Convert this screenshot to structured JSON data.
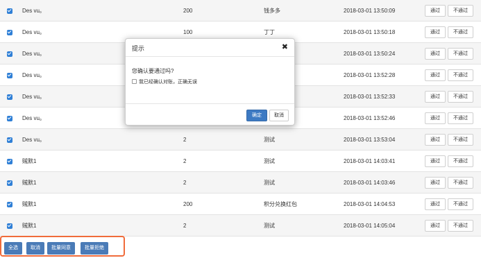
{
  "rows": [
    {
      "name": "Des vu。",
      "amount": "200",
      "desc": "钱多多",
      "time": "2018-03-01 13:50:09",
      "approve": "通过",
      "reject": "不通过"
    },
    {
      "name": "Des vu。",
      "amount": "100",
      "desc": "丁丁",
      "time": "2018-03-01 13:50:18",
      "approve": "通过",
      "reject": "不通过"
    },
    {
      "name": "Des vu。",
      "amount": "",
      "desc": "",
      "time": "2018-03-01 13:50:24",
      "approve": "通过",
      "reject": "不通过"
    },
    {
      "name": "Des vu。",
      "amount": "",
      "desc": "",
      "time": "2018-03-01 13:52:28",
      "approve": "通过",
      "reject": "不通过"
    },
    {
      "name": "Des vu。",
      "amount": "",
      "desc": "",
      "time": "2018-03-01 13:52:33",
      "approve": "通过",
      "reject": "不通过"
    },
    {
      "name": "Des vu。",
      "amount": "",
      "desc": "",
      "time": "2018-03-01 13:52:46",
      "approve": "通过",
      "reject": "不通过"
    },
    {
      "name": "Des vu。",
      "amount": "2",
      "desc": "测试",
      "time": "2018-03-01 13:53:04",
      "approve": "通过",
      "reject": "不通过"
    },
    {
      "name": "贼默1",
      "amount": "2",
      "desc": "测试",
      "time": "2018-03-01 14:03:41",
      "approve": "通过",
      "reject": "不通过"
    },
    {
      "name": "贼默1",
      "amount": "2",
      "desc": "测试",
      "time": "2018-03-01 14:03:46",
      "approve": "通过",
      "reject": "不通过"
    },
    {
      "name": "贼默1",
      "amount": "200",
      "desc": "积分兑换红包",
      "time": "2018-03-01 14:04:53",
      "approve": "通过",
      "reject": "不通过"
    },
    {
      "name": "贼默1",
      "amount": "2",
      "desc": "测试",
      "time": "2018-03-01 14:05:04",
      "approve": "通过",
      "reject": "不通过"
    }
  ],
  "modal": {
    "title": "提示",
    "close_glyph": "✖",
    "question": "您确认要通过吗?",
    "confirm_text": "我已经确认对账，正确无误",
    "ok_label": "确定",
    "cancel_label": "取消"
  },
  "bulk": {
    "select_all": "全选",
    "cancel": "取消",
    "batch_approve": "批量同意",
    "batch_reject": "批量拒绝"
  },
  "colors": {
    "checkbox": "#2f7fd6",
    "primary": "#3d7ac3",
    "bulk_button": "#4a7bb7",
    "highlight_border": "#f06b3a"
  }
}
